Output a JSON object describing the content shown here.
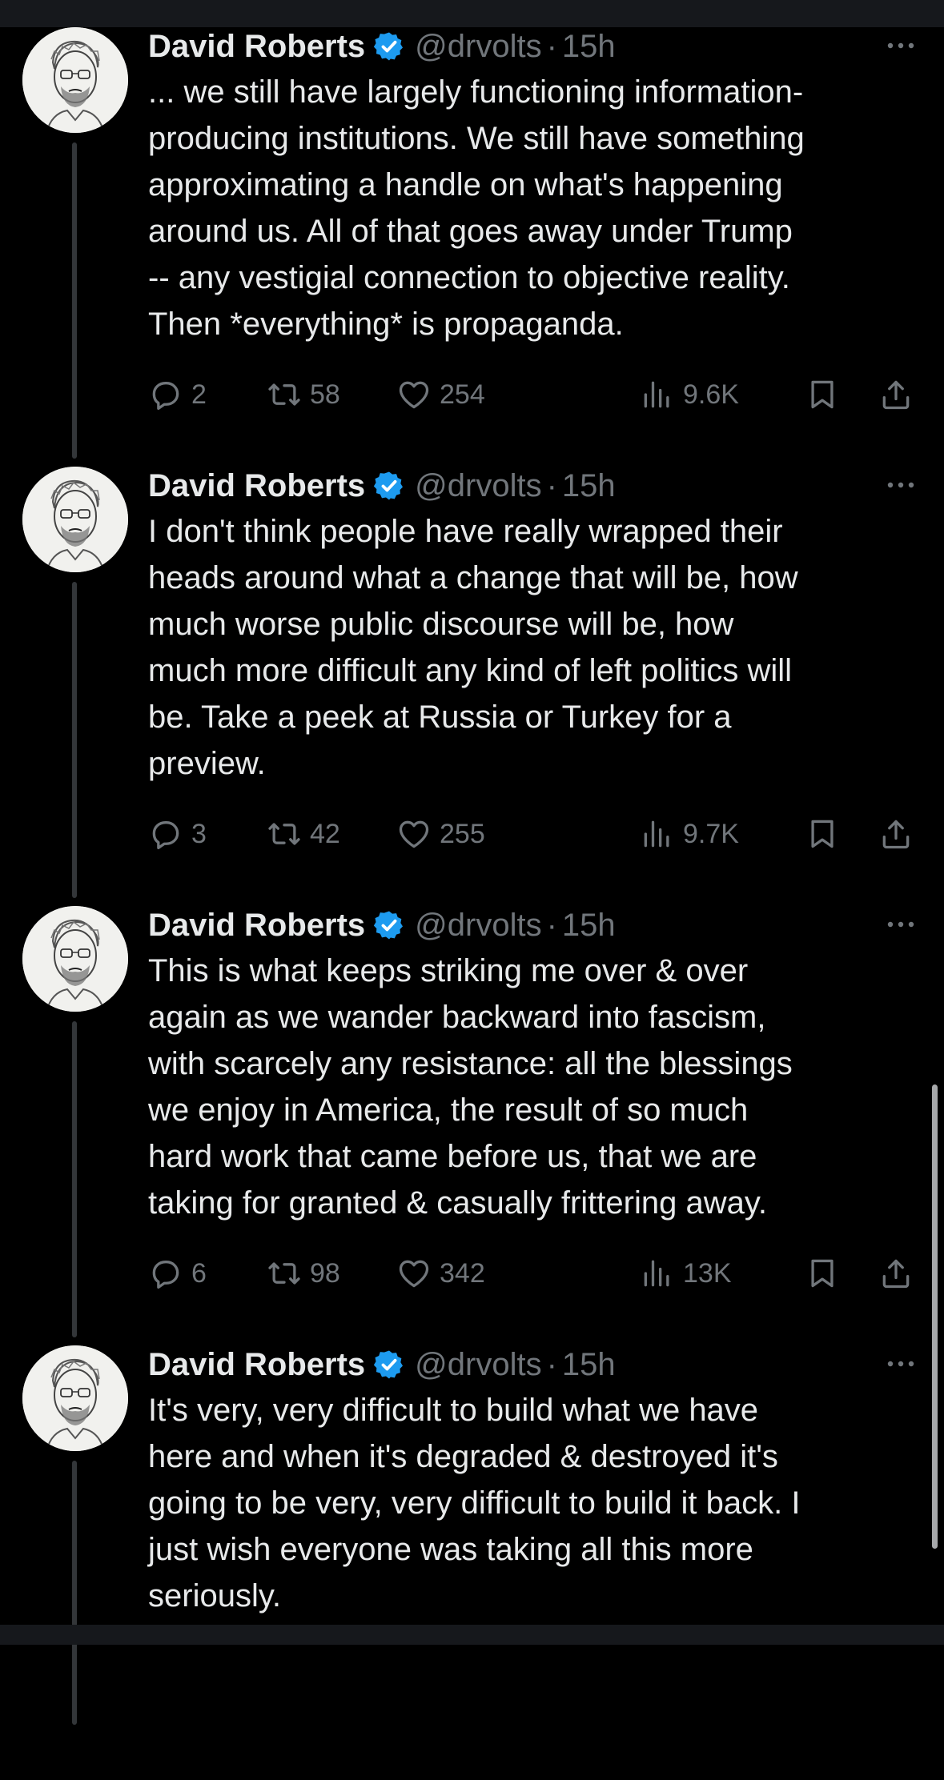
{
  "author": {
    "name": "David Roberts",
    "handle": "@drvolts",
    "separator": "·",
    "time": "15h"
  },
  "icons": {
    "verified": "verified-badge-icon",
    "more": "more-options-icon",
    "reply": "reply-icon",
    "repost": "repost-icon",
    "like": "like-icon",
    "views": "views-icon",
    "bookmark": "bookmark-icon",
    "share": "share-icon"
  },
  "colors": {
    "background": "#000000",
    "text": "#e7e9ea",
    "muted": "#71767b",
    "verified": "#1d9bf0",
    "thread_line": "#333639"
  },
  "tweets": [
    {
      "lines": [
        "... we still have largely functioning information-",
        "producing institutions. We still have something",
        "approximating a handle on what's happening",
        "around us. All of that goes away under Trump",
        "-- any vestigial connection to objective reality.",
        "Then *everything* is propaganda."
      ],
      "replies": "2",
      "reposts": "58",
      "likes": "254",
      "views": "9.6K"
    },
    {
      "lines": [
        "I don't think people have really wrapped their",
        "heads around what a change that will be, how",
        "much worse public discourse will be, how",
        "much more difficult any kind of left politics will",
        "be. Take a peek at Russia or Turkey for a",
        "preview."
      ],
      "replies": "3",
      "reposts": "42",
      "likes": "255",
      "views": "9.7K"
    },
    {
      "lines": [
        "This is what keeps striking me over & over",
        "again as we wander backward into fascism,",
        "with scarcely any resistance: all the blessings",
        "we enjoy in America, the result of so much",
        "hard work that came before us, that we are",
        "taking for granted & casually frittering away."
      ],
      "replies": "6",
      "reposts": "98",
      "likes": "342",
      "views": "13K"
    },
    {
      "lines": [
        "It's very, very difficult to build what we have",
        "here and when it's degraded & destroyed it's",
        "going to be very, very difficult to build it back. I",
        "just wish everyone was taking all this more",
        "seriously."
      ],
      "replies": "",
      "reposts": "",
      "likes": "",
      "views": ""
    }
  ]
}
